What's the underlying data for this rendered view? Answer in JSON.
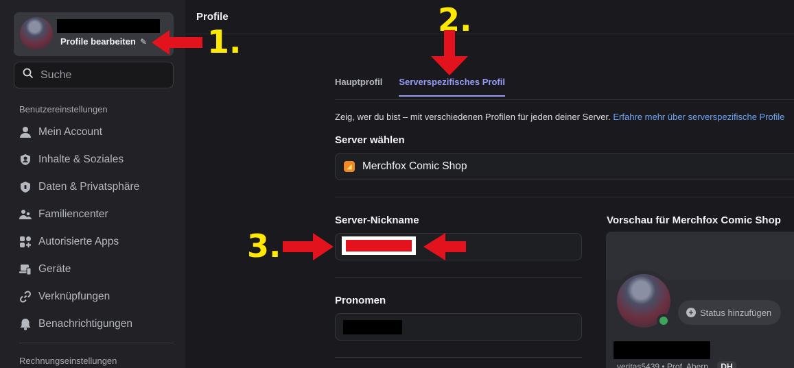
{
  "sidebar": {
    "edit_profile_label": "Profile bearbeiten",
    "search_placeholder": "Suche",
    "section_user": "Benutzereinstellungen",
    "items": [
      {
        "label": "Mein Account",
        "icon": "person-icon"
      },
      {
        "label": "Inhalte & Soziales",
        "icon": "shield-user-icon"
      },
      {
        "label": "Daten & Privatsphäre",
        "icon": "shield-lock-icon"
      },
      {
        "label": "Familiencenter",
        "icon": "family-icon"
      },
      {
        "label": "Autorisierte Apps",
        "icon": "apps-icon"
      },
      {
        "label": "Geräte",
        "icon": "devices-icon"
      },
      {
        "label": "Verknüpfungen",
        "icon": "link-icon"
      },
      {
        "label": "Benachrichtigungen",
        "icon": "bell-icon"
      }
    ],
    "section_billing": "Rechnungseinstellungen"
  },
  "main": {
    "title": "Profile",
    "tabs": [
      {
        "label": "Hauptprofil",
        "active": false
      },
      {
        "label": "Serverspezifisches Profil",
        "active": true
      }
    ],
    "description": "Zeig, wer du bist – mit verschiedenen Profilen für jeden deiner Server.",
    "description_link": "Erfahre mehr über serverspezifische Profile",
    "server_select_label": "Server wählen",
    "selected_server": "Merchfox Comic Shop",
    "nickname_label": "Server-Nickname",
    "pronouns_label": "Pronomen",
    "preview_label": "Vorschau für Merchfox Comic Shop",
    "status_button": "Status hinzufügen",
    "preview_subtext": "veritas5439 • Prof. Abern",
    "preview_badge": "DH"
  },
  "annotations": {
    "one": "1.",
    "two": "2.",
    "three": "3.",
    "arrow_color": "#e3131d",
    "number_color": "#ffe900"
  },
  "colors": {
    "accent": "#949cf7",
    "link": "#6ca4f5",
    "online": "#3ba55c"
  }
}
